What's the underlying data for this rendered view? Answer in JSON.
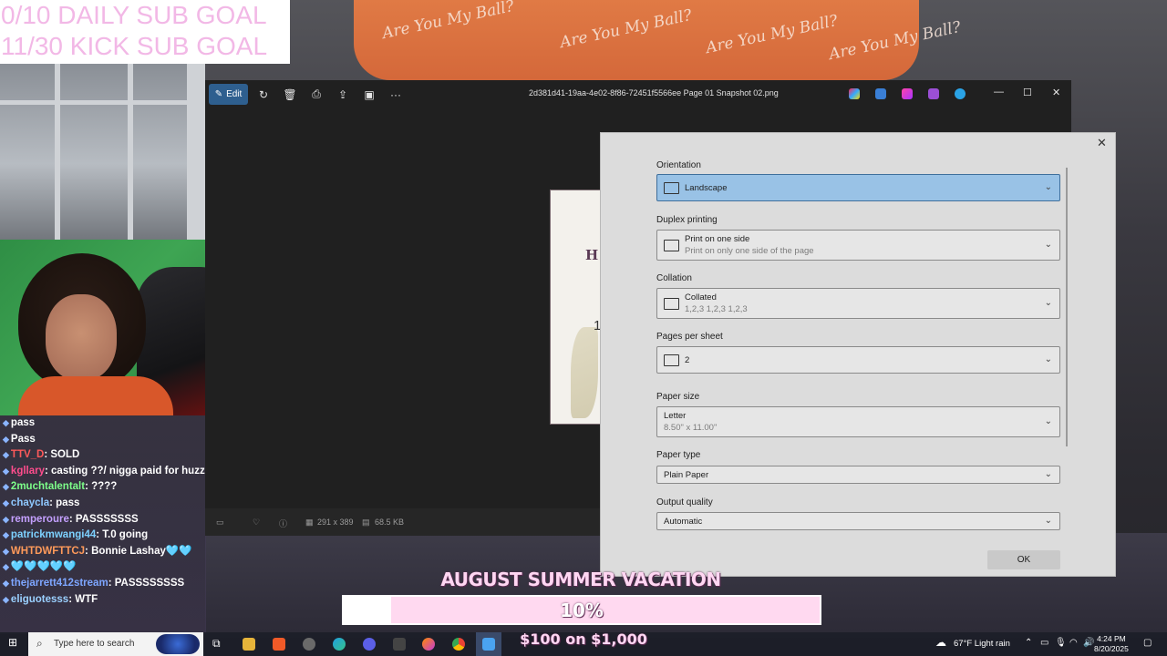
{
  "overlay": {
    "daily_sub_goal": "0/10 DAILY SUB GOAL",
    "kick_sub_goal": "11/30 KICK SUB GOAL"
  },
  "background": {
    "banner_text": "Are You My Ball?"
  },
  "chat": [
    {
      "user": "",
      "message": "pass"
    },
    {
      "user": "",
      "message": "Pass"
    },
    {
      "user": "TTV_D",
      "message": "SOLD"
    },
    {
      "user": "kgllary",
      "message": "casting ??/ nigga paid for huzzz ?"
    },
    {
      "user": "2muchtalentalt",
      "message": "????"
    },
    {
      "user": "chaycla",
      "message": "pass"
    },
    {
      "user": "remperoure",
      "message": "PASSSSSSS"
    },
    {
      "user": "patrickmwangi44",
      "message": "T.0 going"
    },
    {
      "user": "WHTDWFTTCJ",
      "message": "Bonnie Lashay🩵🩵"
    },
    {
      "user": "",
      "message": "🩵🩵🩵🩵🩵"
    },
    {
      "user": "thejarrett412stream",
      "message": "PASSSSSSSS"
    },
    {
      "user": "eliguotesss",
      "message": "WTF"
    }
  ],
  "photos_app": {
    "edit_label": "Edit",
    "file_name": "2d381d41-19aa-4e02-8f86-72451f5566ee Page 01 Snapshot 02.png",
    "status": {
      "dimensions": "291 x 389",
      "file_size": "68.5 KB"
    },
    "preview": {
      "letter": "H",
      "digit": "1"
    }
  },
  "print_dialog": {
    "close_label": "✕",
    "fields": [
      {
        "label": "Orientation",
        "value": "Landscape",
        "sub": "",
        "icon": "landscape-icon",
        "active": true
      },
      {
        "label": "Duplex printing",
        "value": "Print on one side",
        "sub": "Print on only one side of the page",
        "icon": "duplex-icon"
      },
      {
        "label": "Collation",
        "value": "Collated",
        "sub": "1,2,3   1,2,3   1,2,3",
        "icon": "collation-icon"
      },
      {
        "label": "Pages per sheet",
        "value": "2",
        "sub": "",
        "icon": "pages-per-sheet-icon"
      },
      {
        "label": "Paper size",
        "value": "Letter",
        "sub": "8.50\" x 11.00\"",
        "icon": ""
      },
      {
        "label": "Paper type",
        "value": "Plain Paper",
        "sub": "",
        "icon": ""
      },
      {
        "label": "Output quality",
        "value": "Automatic",
        "sub": "",
        "icon": ""
      }
    ],
    "ok_label": "OK"
  },
  "goal": {
    "title": "AUGUST SUMMER VACATION",
    "percent_text": "10%",
    "progress": 0.1,
    "amount_text": "$100 on $1,000"
  },
  "taskbar": {
    "search_placeholder": "Type here to search",
    "weather": "67°F  Light rain",
    "time": "4:24 PM",
    "date": "8/20/2025"
  },
  "colors": {
    "accent": "#2e5f8f",
    "selected_field": "#99c2e6",
    "goal_pink": "#ffd9f0",
    "sub_goal_pink": "#f2b8e6"
  }
}
